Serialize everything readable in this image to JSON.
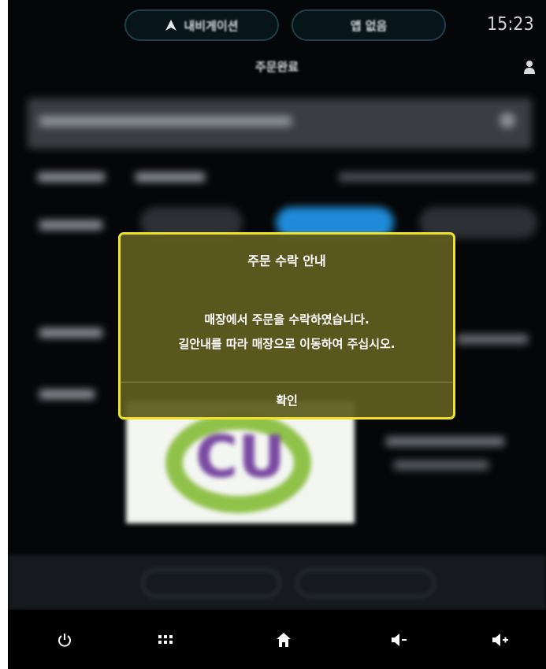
{
  "status_bar": {
    "navigation_label": "내비게이션",
    "app_label": "앱 없음",
    "time": "15:23"
  },
  "header": {
    "title": "주문완료"
  },
  "dialog": {
    "title": "주문 수락 안내",
    "message_line1": "매장에서 주문을 수락하였습니다.",
    "message_line2": "길안내를 따라 매장으로 이동하여 주십시오.",
    "confirm_label": "확인"
  },
  "background": {
    "brand_logo_text": "CU"
  },
  "nav_bar": {
    "icons": [
      "power-icon",
      "apps-grid-icon",
      "home-icon",
      "volume-down-icon",
      "volume-up-icon"
    ]
  },
  "colors": {
    "dialog_border": "#efe32a",
    "dialog_background": "#605c20",
    "screen_background": "#050607",
    "accent_blue": "#1f8bd8"
  }
}
